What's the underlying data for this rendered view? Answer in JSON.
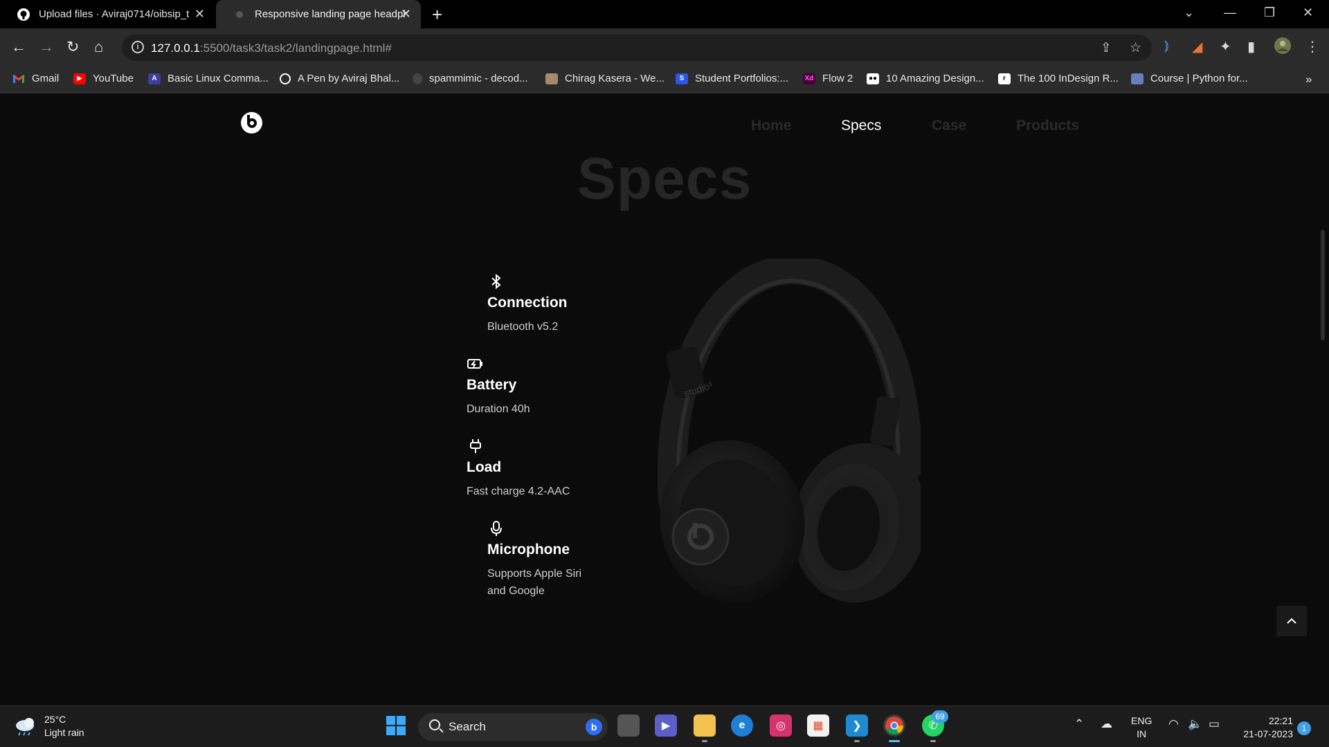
{
  "browser": {
    "tabs": [
      {
        "title": "Upload files · Aviraj0714/oibsip_t",
        "active": false,
        "icon": "github-icon"
      },
      {
        "title": "Responsive landing page headph",
        "active": true,
        "icon": "page-favicon"
      }
    ],
    "url_host": "127.0.0.1",
    "url_rest": ":5500/task3/task2/landingpage.html#",
    "bookmarks": [
      {
        "label": "Gmail",
        "color": "#ea4335",
        "icon": "gmail-icon"
      },
      {
        "label": "YouTube",
        "color": "#ff0000",
        "icon": "youtube-icon"
      },
      {
        "label": "Basic Linux Comma...",
        "color": "#3b3f9e",
        "icon": "bookmark-icon"
      },
      {
        "label": "A Pen by Aviraj Bhal...",
        "color": "#ffffff",
        "icon": "codepen-icon"
      },
      {
        "label": "spammimic - decod...",
        "color": "#555555",
        "icon": "bookmark-icon"
      },
      {
        "label": "Chirag Kasera - We...",
        "color": "#a58a6b",
        "icon": "bookmark-icon"
      },
      {
        "label": "Student Portfolios:...",
        "color": "#2d55e6",
        "icon": "bookmark-icon"
      },
      {
        "label": "Flow 2",
        "color": "#470137",
        "icon": "xd-icon"
      },
      {
        "label": "10 Amazing Design...",
        "color": "#ffffff",
        "icon": "medium-icon"
      },
      {
        "label": "The 100 InDesign R...",
        "color": "#ffffff",
        "icon": "bookmark-icon"
      },
      {
        "label": "Course | Python for...",
        "color": "#6a7dbf",
        "icon": "bookmark-icon"
      }
    ]
  },
  "site": {
    "nav": [
      {
        "label": "Home",
        "active": false
      },
      {
        "label": "Specs",
        "active": true
      },
      {
        "label": "Case",
        "active": false
      },
      {
        "label": "Products",
        "active": false
      }
    ],
    "heading": "Specs",
    "specs": [
      {
        "title": "Connection",
        "desc": "Bluetooth v5.2",
        "icon": "bluetooth-icon"
      },
      {
        "title": "Battery",
        "desc": "Duration 40h",
        "icon": "battery-icon"
      },
      {
        "title": "Load",
        "desc": "Fast charge 4.2-AAC",
        "icon": "plug-icon"
      },
      {
        "title": "Microphone",
        "desc_line1": "Supports Apple Siri",
        "desc_line2": "and Google",
        "icon": "microphone-icon"
      }
    ],
    "product_brand_text": "studio³"
  },
  "taskbar": {
    "temperature": "25°C",
    "condition": "Light rain",
    "search_label": "Search",
    "whatsapp_badge": "69",
    "lang_line1": "ENG",
    "lang_line2": "IN",
    "time": "22:21",
    "date": "21-07-2023",
    "notifications": "1"
  }
}
